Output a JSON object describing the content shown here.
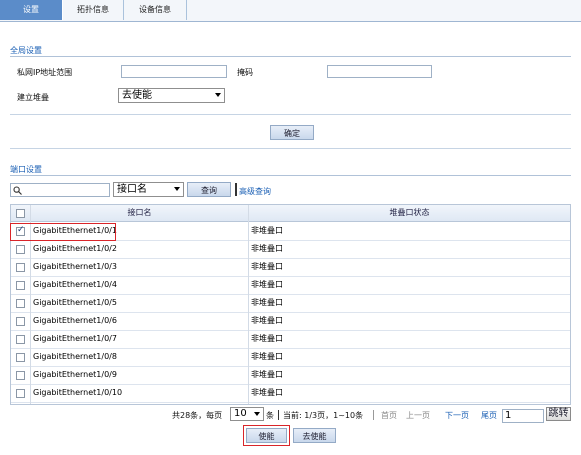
{
  "tabs": [
    {
      "label": "设置",
      "active": true
    },
    {
      "label": "拓扑信息",
      "active": false
    },
    {
      "label": "设备信息",
      "active": false
    }
  ],
  "global": {
    "title": "全局设置",
    "private_ip_label": "私网IP地址范围",
    "private_ip_value": "",
    "mask_label": "掩码",
    "mask_value": "",
    "build_stack_label": "建立堆叠",
    "build_stack_value": "去使能",
    "confirm_label": "确定"
  },
  "port": {
    "title": "端口设置",
    "search_value": "",
    "search_field": "接口名",
    "query_label": "查询",
    "advanced_label": "高级查询",
    "columns": [
      "接口名",
      "堆叠口状态"
    ],
    "rows": [
      {
        "name": "GigabitEthernet1/0/1",
        "status": "非堆叠口",
        "checked": true
      },
      {
        "name": "GigabitEthernet1/0/2",
        "status": "非堆叠口",
        "checked": false
      },
      {
        "name": "GigabitEthernet1/0/3",
        "status": "非堆叠口",
        "checked": false
      },
      {
        "name": "GigabitEthernet1/0/4",
        "status": "非堆叠口",
        "checked": false
      },
      {
        "name": "GigabitEthernet1/0/5",
        "status": "非堆叠口",
        "checked": false
      },
      {
        "name": "GigabitEthernet1/0/6",
        "status": "非堆叠口",
        "checked": false
      },
      {
        "name": "GigabitEthernet1/0/7",
        "status": "非堆叠口",
        "checked": false
      },
      {
        "name": "GigabitEthernet1/0/8",
        "status": "非堆叠口",
        "checked": false
      },
      {
        "name": "GigabitEthernet1/0/9",
        "status": "非堆叠口",
        "checked": false
      },
      {
        "name": "GigabitEthernet1/0/10",
        "status": "非堆叠口",
        "checked": false
      }
    ]
  },
  "pager": {
    "total_text": "共28条，每页",
    "page_size": "10",
    "per_text": "条",
    "current_text": "当前: 1/3页，1~10条",
    "first": "首页",
    "prev": "上一页",
    "next": "下一页",
    "last": "尾页",
    "page_input": "1",
    "jump": "跳转"
  },
  "actions": {
    "enable": "使能",
    "disable": "去使能"
  },
  "colors": {
    "tab_active": "#5b8cc9",
    "link": "#1a5fb4",
    "highlight": "#d9252a"
  },
  "icons": {
    "search": "search-icon",
    "dropdown": "chevron-down-icon"
  }
}
